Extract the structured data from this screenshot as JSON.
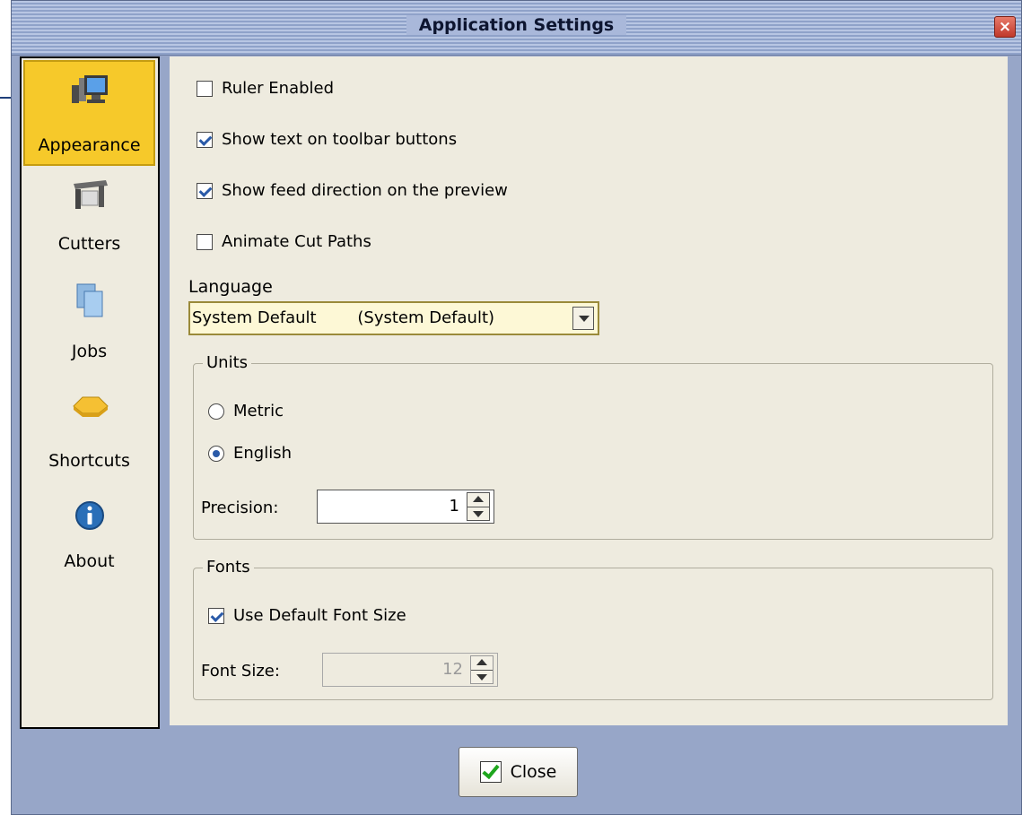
{
  "window": {
    "title": "Application Settings",
    "close_glyph": "×"
  },
  "sidebar": {
    "items": [
      {
        "label": "Appearance",
        "icon": "monitor-icon",
        "active": true
      },
      {
        "label": "Cutters",
        "icon": "cutter-machine-icon",
        "active": false
      },
      {
        "label": "Jobs",
        "icon": "documents-icon",
        "active": false
      },
      {
        "label": "Shortcuts",
        "icon": "shortcut-icon",
        "active": false
      },
      {
        "label": "About",
        "icon": "info-icon",
        "active": false
      }
    ]
  },
  "appearance": {
    "ruler_enabled": {
      "label": "Ruler Enabled",
      "checked": false
    },
    "show_toolbar_text": {
      "label": "Show text on toolbar buttons",
      "checked": true
    },
    "show_feed_direction": {
      "label": "Show feed direction on the preview",
      "checked": true
    },
    "animate_cut_paths": {
      "label": "Animate Cut Paths",
      "checked": false
    },
    "language": {
      "label": "Language",
      "value": "System Default        (System Default)"
    },
    "units": {
      "title": "Units",
      "metric_label": "Metric",
      "english_label": "English",
      "selected": "English",
      "precision_label": "Precision:",
      "precision_value": "1"
    },
    "fonts": {
      "title": "Fonts",
      "use_default_label": "Use Default Font Size",
      "use_default_checked": true,
      "font_size_label": "Font Size:",
      "font_size_value": "12"
    }
  },
  "footer": {
    "close_label": "Close"
  },
  "colors": {
    "active_nav": "#f6c92a",
    "window_bg": "#97a6c8",
    "panel_bg": "#eeebdf",
    "check_accent": "#2a5aa8"
  }
}
